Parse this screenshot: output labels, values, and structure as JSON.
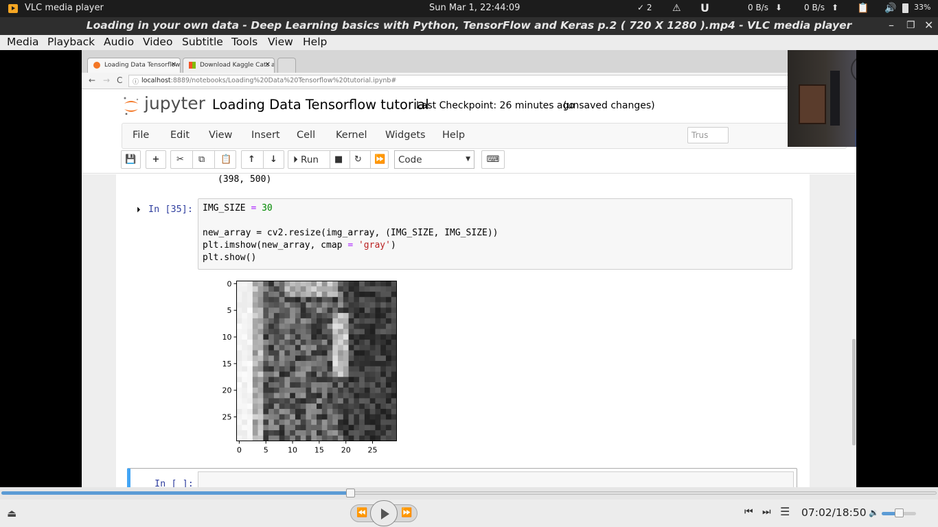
{
  "system_bar": {
    "app_name": "VLC media player",
    "clock": "Sun Mar  1, 22:44:09",
    "check_count": "✓ 2",
    "download_speed": "0 B/s",
    "upload_speed": "0 B/s",
    "battery": "33%"
  },
  "window": {
    "title": "Loading in your own data - Deep Learning basics with Python, TensorFlow and Keras p.2 ( 720 X 1280 ).mp4 - VLC media player"
  },
  "vlc_menu": [
    "Media",
    "Playback",
    "Audio",
    "Video",
    "Subtitle",
    "Tools",
    "View",
    "Help"
  ],
  "browser": {
    "tabs": [
      {
        "label": "Loading Data Tensorflow"
      },
      {
        "label": "Download Kaggle Cats a"
      }
    ],
    "url_host": "localhost",
    "url_rest": ":8889/notebooks/Loading%20Data%20Tensorflow%20tutorial.ipynb#"
  },
  "jupyter": {
    "brand": "jupyter",
    "notebook_title": "Loading Data Tensorflow tutorial",
    "checkpoint": "Last Checkpoint: 26 minutes ago",
    "unsaved": "(unsaved changes)",
    "menu": [
      "File",
      "Edit",
      "View",
      "Insert",
      "Cell",
      "Kernel",
      "Widgets",
      "Help"
    ],
    "trusted_label": "Trus",
    "toolbar": {
      "run_label": "Run",
      "cell_type": "Code"
    },
    "prev_output": "(398, 500)",
    "cell_prompt": "In [35]:",
    "code": {
      "line1_var": "IMG_SIZE",
      "line1_op": "=",
      "line1_num": "30",
      "line3": "new_array = cv2.resize(img_array, (IMG_SIZE, IMG_SIZE))",
      "line4_a": "plt.imshow(new_array, cmap ",
      "line4_op": "=",
      "line4_str": "'gray'",
      "line4_b": ")",
      "line5": "plt.show()"
    },
    "next_prompt": "In [ ]:"
  },
  "chart_data": {
    "type": "heatmap",
    "colormap": "gray",
    "x_ticks": [
      "0",
      "5",
      "10",
      "15",
      "20",
      "25"
    ],
    "y_ticks": [
      "0",
      "5",
      "10",
      "15",
      "20",
      "25"
    ],
    "xlim": [
      0,
      30
    ],
    "ylim": [
      30,
      0
    ]
  },
  "player": {
    "elapsed": "07:02",
    "duration": "18:50",
    "progress": 0.374,
    "volume": 0.5
  }
}
